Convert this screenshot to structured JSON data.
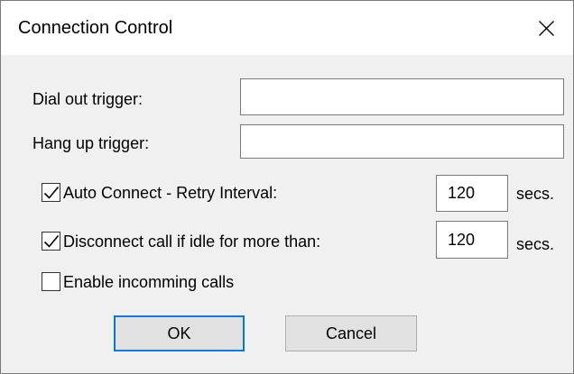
{
  "window": {
    "title": "Connection Control",
    "close_icon": "close-icon"
  },
  "fields": {
    "dial_out": {
      "label": "Dial out trigger:",
      "value": ""
    },
    "hang_up": {
      "label": "Hang up trigger:",
      "value": ""
    }
  },
  "options": {
    "auto_connect": {
      "label": "Auto Connect - Retry Interval:",
      "checked": true,
      "value": "120",
      "unit": "secs."
    },
    "disconnect_idle": {
      "label": "Disconnect call if idle for more than:",
      "checked": true,
      "value": "120",
      "unit": "secs."
    },
    "incoming_calls": {
      "label": "Enable incomming calls",
      "checked": false
    }
  },
  "buttons": {
    "ok": "OK",
    "cancel": "Cancel"
  },
  "colors": {
    "accent": "#0078d7",
    "client_background": "#f0f0f0",
    "button_face": "#e1e1e1"
  }
}
